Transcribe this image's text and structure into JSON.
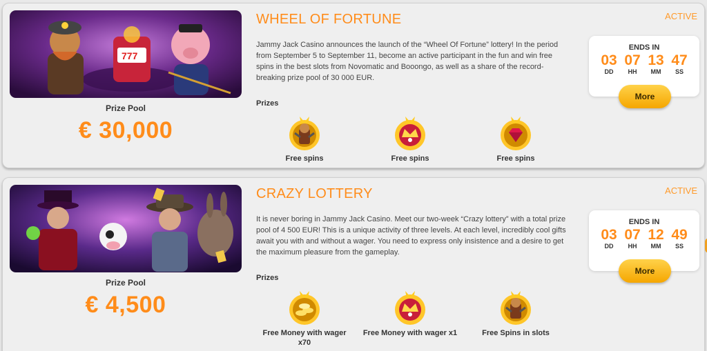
{
  "colors": {
    "accent": "#ff8c1a",
    "button": "#f5a600",
    "card_bg": "#efefef"
  },
  "promotions": [
    {
      "title": "WHEEL OF FORTUNE",
      "status": "ACTIVE",
      "description": "Jammy Jack Casino announces the launch of the “Wheel Of Fortune” lottery! In the period from September 5 to September 11, become an active participant in the fun and win free spins in the best slots from Novomatic and Booongo, as well as a share of the record-breaking prize pool of 30 000 EUR.",
      "prize_pool_label": "Prize Pool",
      "prize_pool_value": "€ 30,000",
      "prizes_label": "Prizes",
      "prizes": [
        {
          "label": "Free spins",
          "icon": "miner-badge-icon"
        },
        {
          "label": "Free spins",
          "icon": "crown-wreath-badge-icon"
        },
        {
          "label": "Free spins",
          "icon": "ruby-badge-icon"
        }
      ],
      "timer": {
        "ends_label": "ENDS IN",
        "units": [
          {
            "value": "03",
            "unit": "DD"
          },
          {
            "value": "07",
            "unit": "HH"
          },
          {
            "value": "13",
            "unit": "MM"
          },
          {
            "value": "47",
            "unit": "SS"
          }
        ]
      },
      "more_label": "More"
    },
    {
      "title": "CRAZY LOTTERY",
      "status": "ACTIVE",
      "description": "It is never boring in Jammy Jack Casino. Meet our two-week “Crazy lottery” with a total prize pool of 4 500 EUR! This is a unique activity of three levels. At each level, incredibly cool gifts await you with and without a wager. You need to express only insistence and a desire to get the maximum pleasure from the gameplay.",
      "prize_pool_label": "Prize Pool",
      "prize_pool_value": "€ 4,500",
      "prizes_label": "Prizes",
      "prizes": [
        {
          "label": "Free Money with wager x70",
          "icon": "coins-badge-icon"
        },
        {
          "label": "Free Money with wager x1",
          "icon": "crown-wreath-badge-icon"
        },
        {
          "label": "Free Spins in slots",
          "icon": "miner-badge-icon"
        }
      ],
      "timer": {
        "ends_label": "ENDS IN",
        "units": [
          {
            "value": "03",
            "unit": "DD"
          },
          {
            "value": "07",
            "unit": "HH"
          },
          {
            "value": "12",
            "unit": "MM"
          },
          {
            "value": "49",
            "unit": "SS"
          }
        ]
      },
      "more_label": "More"
    }
  ]
}
